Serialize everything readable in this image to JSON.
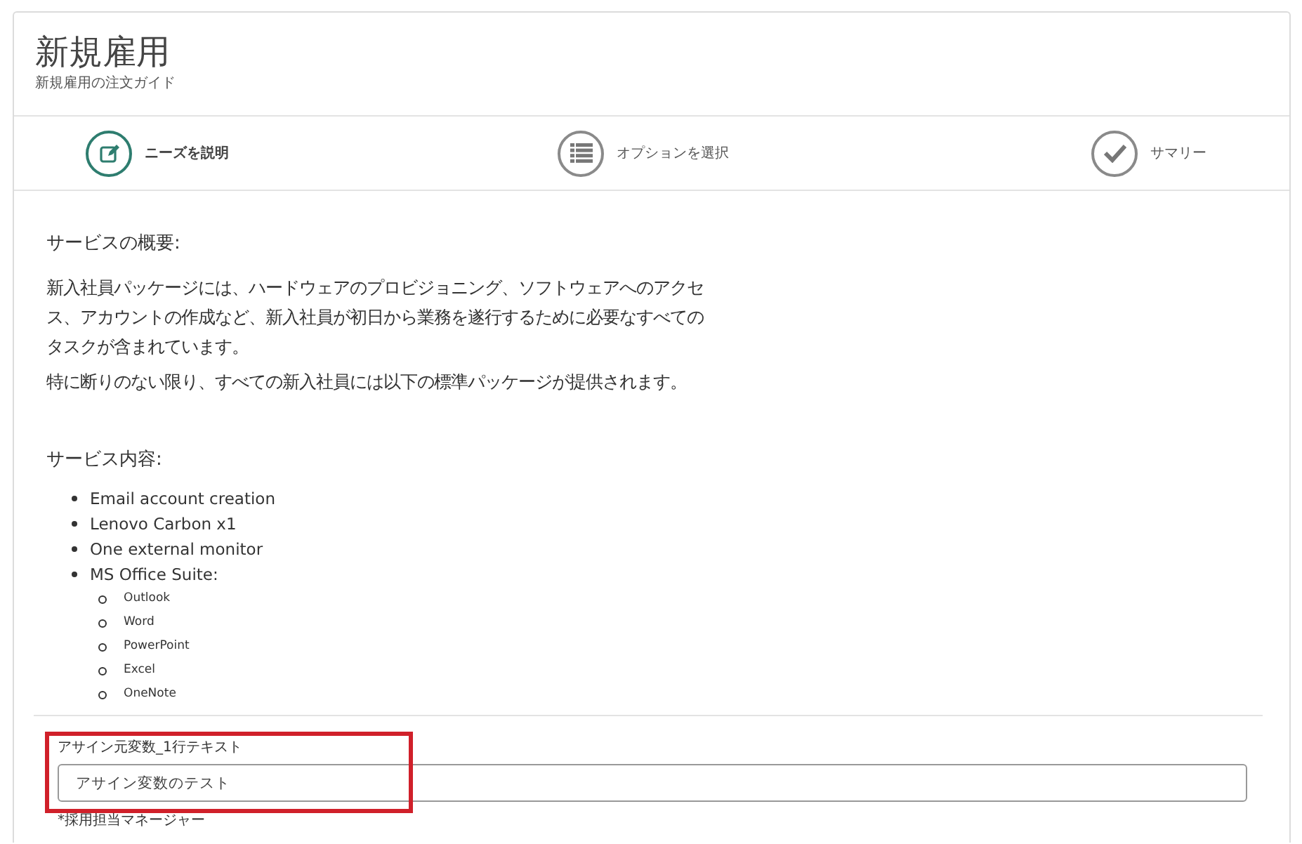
{
  "header": {
    "title": "新規雇用",
    "subtitle": "新規雇用の注文ガイド"
  },
  "steps": [
    {
      "label": "ニーズを説明",
      "selected": true
    },
    {
      "label": "オプションを選択",
      "selected": false
    },
    {
      "label": "サマリー",
      "selected": false
    }
  ],
  "overview": {
    "heading": "サービスの概要:",
    "paragraphs": [
      "新入社員パッケージには、ハードウェアのプロビジョニング、ソフトウェアへのアクセス、アカウントの作成など、新入社員が初日から業務を遂行するために必要なすべてのタスクが含まれています。",
      "特に断りのない限り、すべての新入社員には以下の標準パッケージが提供されます。"
    ]
  },
  "contents": {
    "heading": "サービス内容:",
    "items": [
      {
        "text": "Email account creation"
      },
      {
        "text": "Lenovo Carbon x1"
      },
      {
        "text": "One external monitor"
      },
      {
        "text": "MS Office Suite:",
        "children": [
          {
            "text": "Outlook"
          },
          {
            "text": "Word"
          },
          {
            "text": "PowerPoint"
          },
          {
            "text": "Excel"
          },
          {
            "text": "OneNote"
          }
        ]
      }
    ]
  },
  "fields": [
    {
      "label": "アサイン元変数_1行テキスト",
      "value": "アサイン変数のテスト",
      "highlighted": true
    },
    {
      "label": "*採用担当マネージャー"
    }
  ]
}
